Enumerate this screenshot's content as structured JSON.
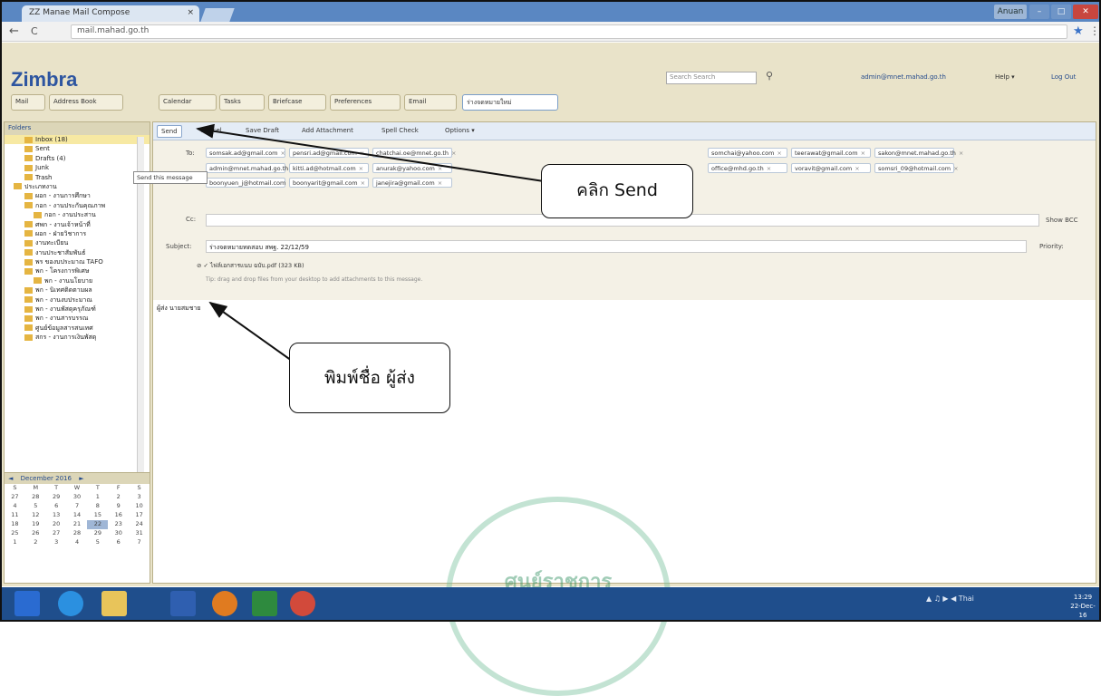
{
  "browser": {
    "tab_title": "ZZ Manae Mail Compose",
    "tab_close": "×",
    "url": "mail.mahad.go.th",
    "profile_label": "Anuan",
    "back": "←",
    "reload": "C",
    "star": "★",
    "menu": "⋮"
  },
  "app": {
    "logo": "Zimbra",
    "search_placeholder": "Search Search",
    "user_email": "admin@mnet.mahad.go.th",
    "help_label": "Help ▾",
    "logout_label": "Log Out",
    "tabs": [
      "Mail",
      "Address Book",
      "Calendar",
      "Tasks",
      "Briefcase",
      "Preferences",
      "Email",
      "ร่างจดหมายใหม่"
    ]
  },
  "sidebar": {
    "header": "Folders",
    "folders": [
      {
        "label": "Inbox (18)",
        "level": 1,
        "selected": true
      },
      {
        "label": "Sent",
        "level": 1,
        "selected": false
      },
      {
        "label": "Drafts (4)",
        "level": 1,
        "selected": false
      },
      {
        "label": "Junk",
        "level": 1,
        "selected": false
      },
      {
        "label": "Trash",
        "level": 1,
        "selected": false
      },
      {
        "label": "ประเภทงาน",
        "level": 0,
        "selected": false
      },
      {
        "label": "ผอก - งานการศึกษา",
        "level": 1,
        "selected": false
      },
      {
        "label": "กอก - งานประกันคุณภาพ",
        "level": 1,
        "selected": false
      },
      {
        "label": "กอก - งานประสาน",
        "level": 2,
        "selected": false
      },
      {
        "label": "ศพก - งานเจ้าหน้าที่",
        "level": 1,
        "selected": false
      },
      {
        "label": "ผอก - ฝ่ายวิชาการ",
        "level": 1,
        "selected": false
      },
      {
        "label": "งานทะเบียน",
        "level": 1,
        "selected": false
      },
      {
        "label": "งานประชาสัมพันธ์",
        "level": 1,
        "selected": false
      },
      {
        "label": "พร ของบประมาณ TAFO",
        "level": 1,
        "selected": false
      },
      {
        "label": "พก - โครงการพิเศษ",
        "level": 1,
        "selected": false
      },
      {
        "label": "พก - งานนโยบาย",
        "level": 2,
        "selected": false
      },
      {
        "label": "พก - นิเทศติดตามผล",
        "level": 1,
        "selected": false
      },
      {
        "label": "พก - งานงบประมาณ",
        "level": 1,
        "selected": false
      },
      {
        "label": "พก - งานพัสดุครุภัณฑ์",
        "level": 1,
        "selected": false
      },
      {
        "label": "พก - งานสารบรรณ",
        "level": 1,
        "selected": false
      },
      {
        "label": "ศูนย์ข้อมูลสารสนเทศ",
        "level": 1,
        "selected": false
      },
      {
        "label": "สกร - งานการเงินพัสดุ",
        "level": 1,
        "selected": false
      }
    ],
    "calendar": {
      "title": "December 2016",
      "prev": "◄",
      "next": "►",
      "weekdays": [
        "S",
        "M",
        "T",
        "W",
        "T",
        "F",
        "S"
      ],
      "weeks": [
        [
          "27",
          "28",
          "29",
          "30",
          "1",
          "2",
          "3"
        ],
        [
          "4",
          "5",
          "6",
          "7",
          "8",
          "9",
          "10"
        ],
        [
          "11",
          "12",
          "13",
          "14",
          "15",
          "16",
          "17"
        ],
        [
          "18",
          "19",
          "20",
          "21",
          "22",
          "23",
          "24"
        ],
        [
          "25",
          "26",
          "27",
          "28",
          "29",
          "30",
          "31"
        ],
        [
          "1",
          "2",
          "3",
          "4",
          "5",
          "6",
          "7"
        ]
      ],
      "today": "22"
    }
  },
  "compose": {
    "toolbar": {
      "send": "Send",
      "cancel": "Cancel",
      "save_draft": "Save Draft",
      "add_attachment": "Add Attachment",
      "spell_check": "Spell Check",
      "options": "Options ▾"
    },
    "send_tooltip": "Send this message",
    "to_label": "To:",
    "cc_label": "Cc:",
    "show_bcc": "Show BCC",
    "subject_label": "Subject:",
    "subject_value": "ร่างจดหมายทดสอบ สพฐ. 22/12/59",
    "priority_label": "Priority:",
    "attachment": "ไฟล์เอกสารแนบ ฉบับ.pdf (323 KB)",
    "tip": "Tip: drag and drop files from your desktop to add attachments to this message.",
    "body_text": "ผู้ส่ง นายสมชาย",
    "recipients": [
      "somsak.ad@gmail.com",
      "pensri.ad@gmail.com",
      "chatchai.oe@mnet.go.th",
      "somchai@yahoo.com",
      "teerawat@gmail.com",
      "sakon@mnet.mahad.go.th",
      "admin@mnet.mahad.go.th",
      "kitti.ad@hotmail.com",
      "anurak@yahoo.com",
      "office@mhd.go.th",
      "voravit@gmail.com",
      "somsri_09@hotmail.com",
      "boonyuen_j@hotmail.com",
      "boonyarit@gmail.com",
      "janejira@gmail.com"
    ]
  },
  "annotations": {
    "send_callout": "คลิก Send",
    "sender_callout": "พิมพ์ชื่อ ผู้ส่ง"
  },
  "watermark": "ศูนย์ราชการ",
  "taskbar": {
    "tray": "▲ ♫ ▶ ◀ Thai",
    "time": "13:29",
    "date": "22-Dec-16"
  }
}
